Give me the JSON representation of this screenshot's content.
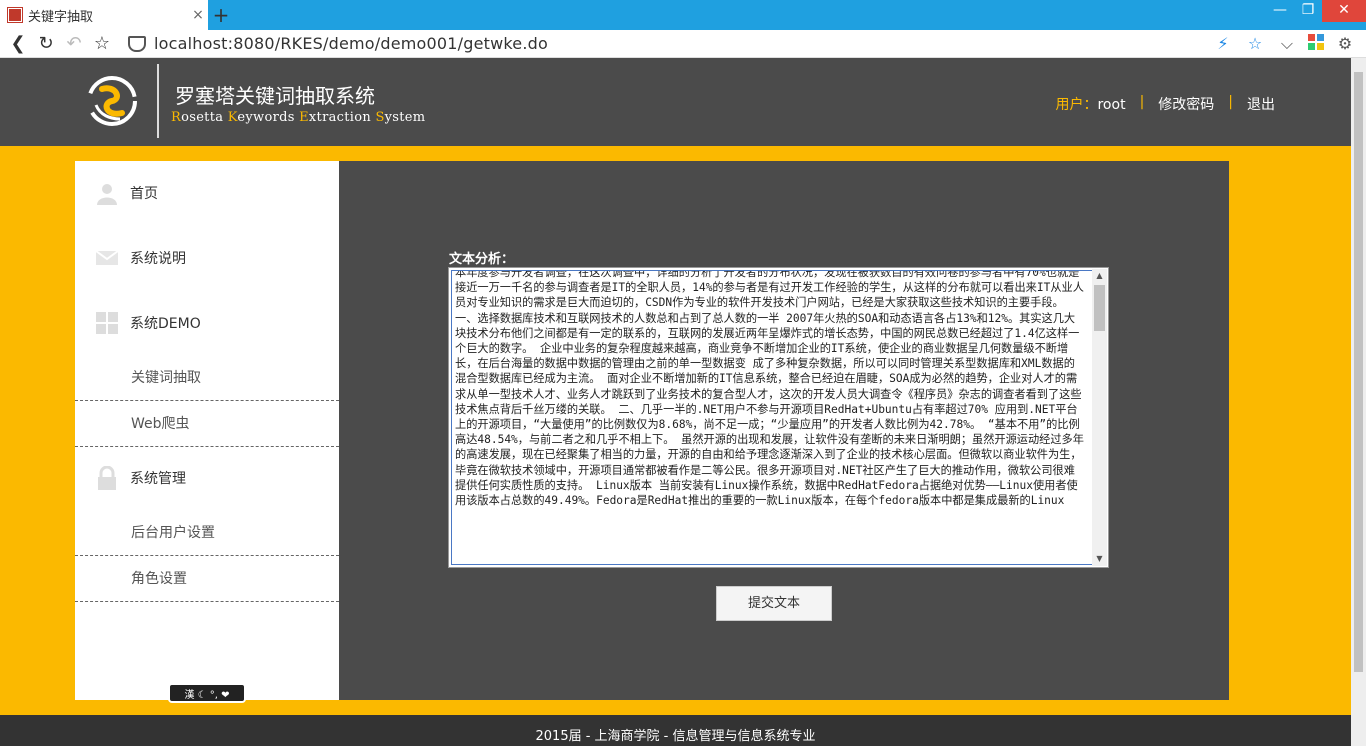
{
  "browser": {
    "tab_title": "关键字抽取",
    "tab_close": "×",
    "new_tab": "+",
    "url": "localhost:8080/RKES/demo/demo001/getwke.do",
    "window_buttons": [
      "—",
      "❐",
      "✕"
    ]
  },
  "header": {
    "title": "罗塞塔关键词抽取系统",
    "subtitle_parts": [
      {
        "letter": "R",
        "rest": "osetta "
      },
      {
        "letter": "K",
        "rest": "eywords "
      },
      {
        "letter": "E",
        "rest": "xtraction "
      },
      {
        "letter": "S",
        "rest": "ystem"
      }
    ],
    "user_label": "用户：",
    "user_name": "root",
    "separator": "|",
    "change_password": "修改密码",
    "logout": "退出"
  },
  "sidebar": {
    "home": "首页",
    "system_desc": "系统说明",
    "system_demo": "系统DEMO",
    "keyword_extract": "关键词抽取",
    "web_crawler": "Web爬虫",
    "system_admin": "系统管理",
    "backend_user": "后台用户设置",
    "role_setting": "角色设置"
  },
  "main": {
    "label": "文本分析：",
    "text": "本年度参与开发者调查，在这次调查中，详细的分析了开发者的分布状况，发现在被获数目的有效问卷的参与者中有70%也就是接近一万一千名的参与调查者是IT的全职人员，14%的参与者是有过开发工作经验的学生，从这样的分布就可以看出来IT从业人员对专业知识的需求是巨大而迫切的，CSDN作为专业的软件开发技术门户网站，已经是大家获取这些技术知识的主要手段。  一、选择数据库技术和互联网技术的人数总和占到了总人数的一半 2007年火热的SOA和动态语言各占13%和12%。其实这几大块技术分布他们之间都是有一定的联系的，互联网的发展近两年呈爆炸式的增长态势，中国的网民总数已经超过了1.4亿这样一个巨大的数字。 企业中业务的复杂程度越来越高，商业竞争不断增加企业的IT系统，使企业的商业数据呈几何数量级不断增长，在后台海量的数据中数据的管理由之前的单一型数据变  成了多种复杂数据，所以可以同时管理关系型数据库和XML数据的混合型数据库已经成为主流。 面对企业不断增加新的IT信息系统，整合已经迫在眉睫，SOA成为必然的趋势，企业对人才的需求从单一型技术人才、业务人才跳跃到了业务技术的复合型人才，这次的开发人员大调查令《程序员》杂志的调查者看到了这些技术焦点背后千丝万缕的关联。 二、几乎一半的.NET用户不参与开源项目RedHat+Ubuntu占有率超过70% 应用到.NET平台上的开源项目，“大量使用”的比例数仅为8.68%，尚不足一成；“少量应用”的开发者人数比例为42.78%。  “基本不用”的比例高达48.54%，与前二者之和几乎不相上下。 虽然开源的出现和发展，让软件没有垄断的未来日渐明朗；虽然开源运动经过多年的高速发展，现在已经聚集了相当的力量，开源的自由和给予理念逐渐深入到了企业的技术核心层面。但微软以商业软件为生，毕竟在微软技术领域中，开源项目通常都被看作是二等公民。很多开源项目对.NET社区产生了巨大的推动作用，微软公司很难提供任何实质性质的支持。 Linux版本 当前安装有Linux操作系统，数据中RedHatFedora占据绝对优势——Linux使用者使用该版本占总数的49.49%。Fedora是RedHat推出的重要的一款Linux版本，在每个fedora版本中都是集成最新的Linux",
    "submit": "提交文本"
  },
  "widget": {
    "text": "漢 ☾ °, ❤"
  },
  "footer": {
    "text": "2015届 - 上海商学院 - 信息管理与信息系统专业"
  },
  "colors": {
    "accent": "#fbb900",
    "dark": "#4b4b4b",
    "browser_blue": "#1fa0e0"
  }
}
